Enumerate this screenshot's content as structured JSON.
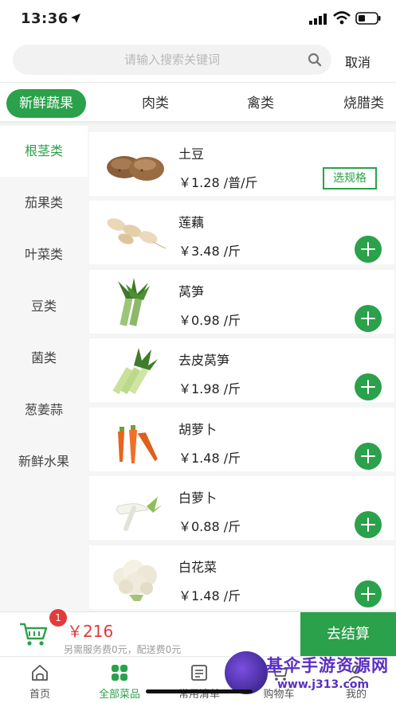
{
  "status_bar": {
    "time": "13:36"
  },
  "search": {
    "placeholder": "请输入搜索关键词",
    "cancel_label": "取消"
  },
  "categories": [
    {
      "label": "新鲜蔬果",
      "active": true
    },
    {
      "label": "肉类",
      "active": false
    },
    {
      "label": "禽类",
      "active": false
    },
    {
      "label": "烧腊类",
      "active": false
    }
  ],
  "side_nav": [
    {
      "label": "根茎类",
      "active": true
    },
    {
      "label": "茄果类",
      "active": false
    },
    {
      "label": "叶菜类",
      "active": false
    },
    {
      "label": "豆类",
      "active": false
    },
    {
      "label": "菌类",
      "active": false
    },
    {
      "label": "葱姜蒜",
      "active": false
    },
    {
      "label": "新鲜水果",
      "active": false
    }
  ],
  "products": [
    {
      "name": "土豆",
      "price": "￥1.28 /普/斤",
      "action": "spec",
      "action_label": "选规格",
      "image": "potato"
    },
    {
      "name": "莲藕",
      "price": "￥3.48 /斤",
      "action": "add",
      "image": "lotus-root"
    },
    {
      "name": "莴笋",
      "price": "￥0.98 /斤",
      "action": "add",
      "image": "celtuce"
    },
    {
      "name": "去皮莴笋",
      "price": "￥1.98 /斤",
      "action": "add",
      "image": "peeled-celtuce"
    },
    {
      "name": "胡萝卜",
      "price": "￥1.48 /斤",
      "action": "add",
      "image": "carrot"
    },
    {
      "name": "白萝卜",
      "price": "￥0.88 /斤",
      "action": "add",
      "image": "white-radish"
    },
    {
      "name": "白花菜",
      "price": "￥1.48 /斤",
      "action": "add",
      "image": "cauliflower"
    }
  ],
  "cart": {
    "badge": "1",
    "total": "￥216",
    "fee_note": "另需服务费0元，配送费0元",
    "checkout_label": "去结算"
  },
  "tabbar": [
    {
      "label": "首页",
      "icon": "home-icon",
      "active": false
    },
    {
      "label": "全部菜品",
      "icon": "grid-icon",
      "active": true
    },
    {
      "label": "常用清单",
      "icon": "list-icon",
      "active": false
    },
    {
      "label": "购物车",
      "icon": "cart-icon",
      "active": false
    },
    {
      "label": "我的",
      "icon": "user-icon",
      "active": false
    }
  ],
  "watermark": {
    "title": "基伞手游资源网",
    "url": "www.j313.com"
  },
  "colors": {
    "accent": "#2aa14a",
    "price_red": "#e33a3a",
    "purple": "#5a2fc2"
  }
}
